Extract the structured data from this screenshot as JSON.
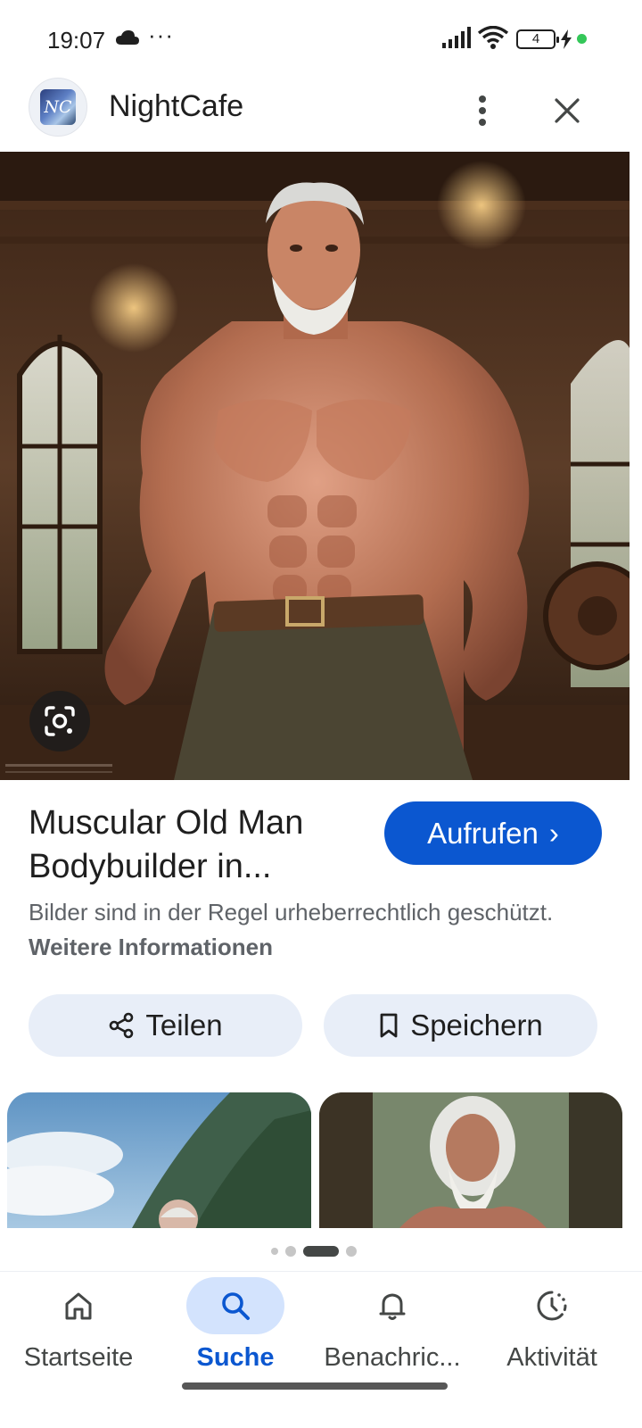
{
  "status_bar": {
    "time": "19:07",
    "overflow": "···",
    "battery_level": "4",
    "icons": [
      "cloud-icon",
      "signal-icon",
      "wifi-icon",
      "battery-icon",
      "charging-bolt-icon"
    ],
    "indicator_color": "#34c759"
  },
  "header": {
    "site_name": "NightCafe",
    "logo_text": "NC"
  },
  "result": {
    "title": "Muscular Old Man Bodybuilder in...",
    "visit_label": "Aufrufen",
    "visit_chevron": "›",
    "copyright_text": "Bilder sind in der Regel urheberrechtlich geschützt.",
    "more_info_link": "Weitere Informationen"
  },
  "actions": {
    "share_label": "Teilen",
    "save_label": "Speichern"
  },
  "pagination": {
    "page_count": 4,
    "active_index": 2
  },
  "bottom_nav": {
    "items": [
      {
        "label": "Startseite",
        "icon": "home-icon",
        "active": false
      },
      {
        "label": "Suche",
        "icon": "search-icon",
        "active": true
      },
      {
        "label": "Benachric...",
        "icon": "bell-icon",
        "active": false
      },
      {
        "label": "Aktivität",
        "icon": "activity-icon",
        "active": false
      }
    ]
  },
  "colors": {
    "accent": "#0b57d0",
    "tonal_button": "#e8eef8",
    "active_nav_pill": "#d3e3fd",
    "secondary_text": "#5f6368"
  }
}
